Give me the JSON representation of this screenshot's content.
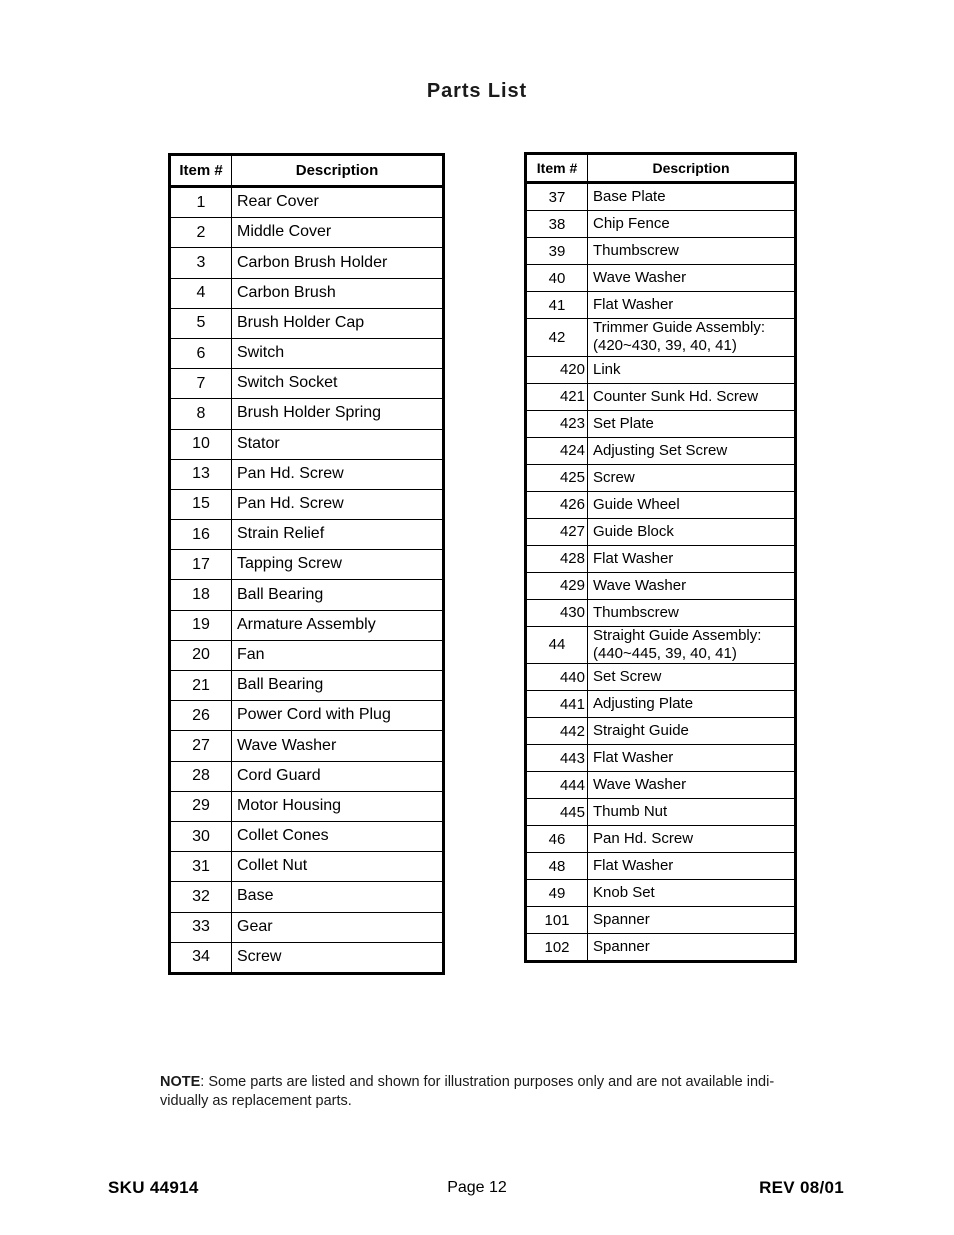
{
  "document": {
    "title": "Parts List"
  },
  "tables": {
    "left": {
      "headers": {
        "item": "Item #",
        "description": "Description"
      },
      "rows": [
        {
          "item": "1",
          "desc": "Rear Cover"
        },
        {
          "item": "2",
          "desc": "Middle Cover"
        },
        {
          "item": "3",
          "desc": "Carbon Brush Holder"
        },
        {
          "item": "4",
          "desc": "Carbon Brush"
        },
        {
          "item": "5",
          "desc": "Brush Holder Cap"
        },
        {
          "item": "6",
          "desc": "Switch"
        },
        {
          "item": "7",
          "desc": "Switch Socket"
        },
        {
          "item": "8",
          "desc": "Brush Holder Spring"
        },
        {
          "item": "10",
          "desc": "Stator"
        },
        {
          "item": "13",
          "desc": "Pan Hd. Screw"
        },
        {
          "item": "15",
          "desc": "Pan Hd. Screw"
        },
        {
          "item": "16",
          "desc": "Strain Relief"
        },
        {
          "item": "17",
          "desc": "Tapping Screw"
        },
        {
          "item": "18",
          "desc": "Ball Bearing"
        },
        {
          "item": "19",
          "desc": "Armature Assembly"
        },
        {
          "item": "20",
          "desc": "Fan"
        },
        {
          "item": "21",
          "desc": "Ball Bearing"
        },
        {
          "item": "26",
          "desc": "Power Cord with Plug"
        },
        {
          "item": "27",
          "desc": "Wave Washer"
        },
        {
          "item": "28",
          "desc": "Cord Guard"
        },
        {
          "item": "29",
          "desc": "Motor Housing"
        },
        {
          "item": "30",
          "desc": "Collet Cones"
        },
        {
          "item": "31",
          "desc": "Collet Nut"
        },
        {
          "item": "32",
          "desc": "Base"
        },
        {
          "item": "33",
          "desc": "Gear"
        },
        {
          "item": "34",
          "desc": "Screw"
        }
      ]
    },
    "right": {
      "headers": {
        "item": "Item #",
        "description": "Description"
      },
      "rows": [
        {
          "item": "37",
          "desc": "Base Plate"
        },
        {
          "item": "38",
          "desc": "Chip Fence"
        },
        {
          "item": "39",
          "desc": "Thumbscrew"
        },
        {
          "item": "40",
          "desc": "Wave Washer"
        },
        {
          "item": "41",
          "desc": "Flat Washer"
        },
        {
          "item": "42",
          "desc": "Trimmer Guide Assembly:\n(420~430, 39, 40, 41)",
          "multiline": true
        },
        {
          "item": "420",
          "desc": "Link",
          "sub": true
        },
        {
          "item": "421",
          "desc": "Counter Sunk Hd. Screw",
          "sub": true
        },
        {
          "item": "423",
          "desc": "Set Plate",
          "sub": true
        },
        {
          "item": "424",
          "desc": "Adjusting Set Screw",
          "sub": true
        },
        {
          "item": "425",
          "desc": "Screw",
          "sub": true
        },
        {
          "item": "426",
          "desc": "Guide Wheel",
          "sub": true
        },
        {
          "item": "427",
          "desc": "Guide Block",
          "sub": true
        },
        {
          "item": "428",
          "desc": "Flat Washer",
          "sub": true
        },
        {
          "item": "429",
          "desc": "Wave Washer",
          "sub": true
        },
        {
          "item": "430",
          "desc": "Thumbscrew",
          "sub": true
        },
        {
          "item": "44",
          "desc": "Straight Guide Assembly:\n(440~445, 39, 40, 41)",
          "multiline": true
        },
        {
          "item": "440",
          "desc": "Set Screw",
          "sub": true
        },
        {
          "item": "441",
          "desc": "Adjusting Plate",
          "sub": true
        },
        {
          "item": "442",
          "desc": "Straight Guide",
          "sub": true
        },
        {
          "item": "443",
          "desc": "Flat Washer",
          "sub": true
        },
        {
          "item": "444",
          "desc": "Wave Washer",
          "sub": true
        },
        {
          "item": "445",
          "desc": "Thumb Nut",
          "sub": true
        },
        {
          "item": "46",
          "desc": "Pan Hd. Screw"
        },
        {
          "item": "48",
          "desc": "Flat Washer"
        },
        {
          "item": "49",
          "desc": "Knob Set"
        },
        {
          "item": "101",
          "desc": "Spanner"
        },
        {
          "item": "102",
          "desc": "Spanner"
        }
      ]
    }
  },
  "note": {
    "label": "NOTE",
    "text": ": Some parts are listed and shown for illustration purposes only and are not available indi-vidually as replacement parts."
  },
  "footer": {
    "sku": "SKU 44914",
    "page": "Page 12",
    "revision": "REV 08/01"
  }
}
